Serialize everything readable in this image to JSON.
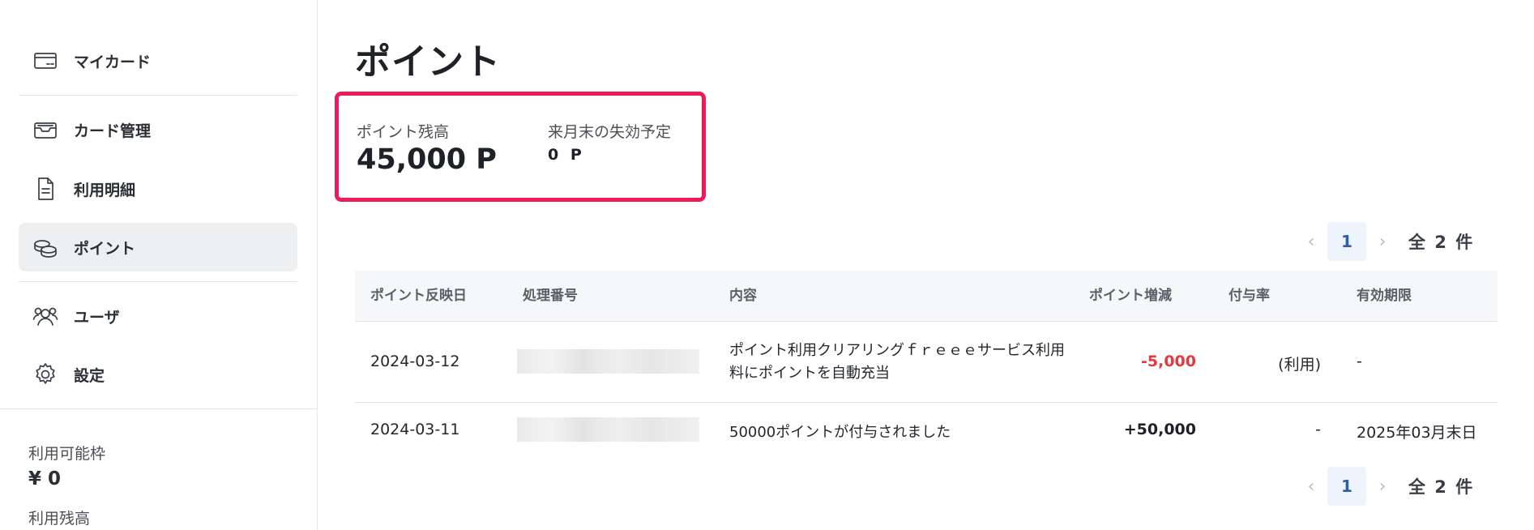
{
  "sidebar": {
    "items": [
      {
        "label": "マイカード",
        "icon": "card-icon"
      },
      {
        "label": "カード管理",
        "icon": "card-tray-icon"
      },
      {
        "label": "利用明細",
        "icon": "document-icon"
      },
      {
        "label": "ポイント",
        "icon": "coins-icon",
        "active": true
      },
      {
        "label": "ユーザ",
        "icon": "users-icon"
      },
      {
        "label": "設定",
        "icon": "gear-icon"
      }
    ],
    "limit_label": "利用可能枠",
    "limit_value": "¥ 0",
    "balance_label": "利用残高"
  },
  "page": {
    "title": "ポイント"
  },
  "balance": {
    "label": "ポイント残高",
    "value": "45,000 P",
    "expire_label": "来月末の失効予定",
    "expire_value": "0 P",
    "highlight_color": "#ec1c5a"
  },
  "pagination": {
    "prev": "‹",
    "next": "›",
    "current_page": "1",
    "total_text": "全 2 件"
  },
  "table": {
    "headers": [
      "ポイント反映日",
      "処理番号",
      "内容",
      "ポイント増減",
      "付与率",
      "有効期限"
    ],
    "rows": [
      {
        "date": "2024-03-12",
        "desc_line1": "ポイント利用クリアリングｆｒｅｅｅサービス利用",
        "desc_line2": "料にポイントを自動充当",
        "change": "-5,000",
        "rate": "(利用)",
        "expiry": "-"
      },
      {
        "date": "2024-03-11",
        "desc_line1": "50000ポイントが付与されました",
        "desc_line2": "",
        "change": "+50,000",
        "rate": "-",
        "expiry": "2025年03月末日"
      }
    ]
  },
  "colors": {
    "negative": "#e5393d",
    "active_bg": "#eeeff1",
    "page_active_bg": "#eef4fc"
  }
}
